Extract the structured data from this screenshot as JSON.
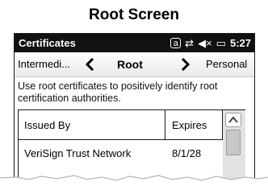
{
  "caption": "Root Screen",
  "status_bar": {
    "app_title": "Certificates",
    "keyboard_indicator": "a",
    "icons": [
      "connection-icon",
      "speaker-muted-icon",
      "battery-icon"
    ],
    "time": "5:27"
  },
  "nav": {
    "previous": "Intermedi...",
    "current": "Root",
    "next": "Personal"
  },
  "description": "Use root certificates to positively identify root certification authorities.",
  "table": {
    "columns": [
      "Issued By",
      "Expires"
    ],
    "rows": [
      {
        "issued_by": "VeriSign Trust Network",
        "expires": "8/1/28"
      }
    ]
  }
}
